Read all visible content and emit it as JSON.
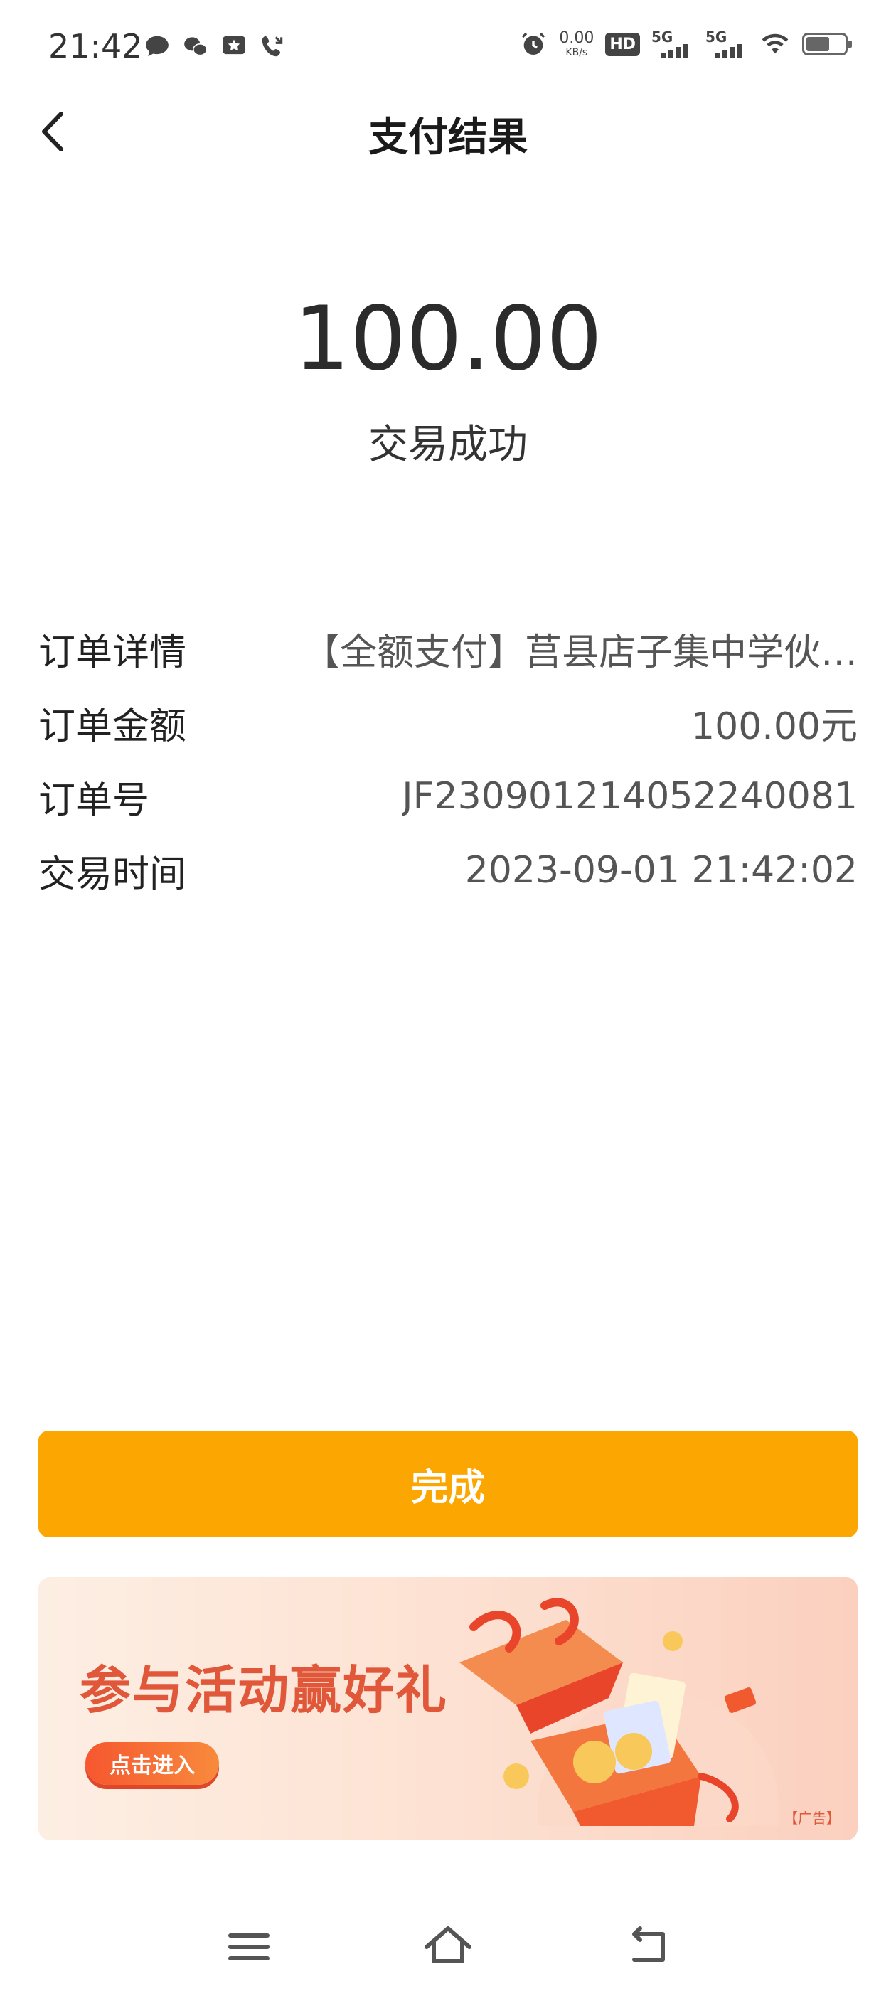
{
  "status_bar": {
    "time": "21:42",
    "net_speed_value": "0.00",
    "net_speed_unit": "KB/s",
    "hd_label": "HD",
    "signal1_label": "5G",
    "signal2_label": "5G",
    "icons": [
      "message-icon",
      "wechat-icon",
      "star-icon",
      "missed-call-icon",
      "alarm-icon",
      "wifi-icon",
      "battery-icon"
    ]
  },
  "header": {
    "title": "支付结果"
  },
  "result": {
    "amount": "100.00",
    "status": "交易成功"
  },
  "details": [
    {
      "label": "订单详情",
      "value": "【全额支付】莒县店子集中学伙…"
    },
    {
      "label": "订单金额",
      "value": "100.00元"
    },
    {
      "label": "订单号",
      "value": "JF2309012140522400​81"
    },
    {
      "label": "交易时间",
      "value": "2023-09-01 21:42:02"
    }
  ],
  "actions": {
    "done_label": "完成"
  },
  "banner": {
    "title": "参与活动赢好礼",
    "button_label": "点击进入",
    "ad_label": "【广告】"
  },
  "colors": {
    "accent": "#FCA602",
    "banner_text": "#E0573A"
  }
}
